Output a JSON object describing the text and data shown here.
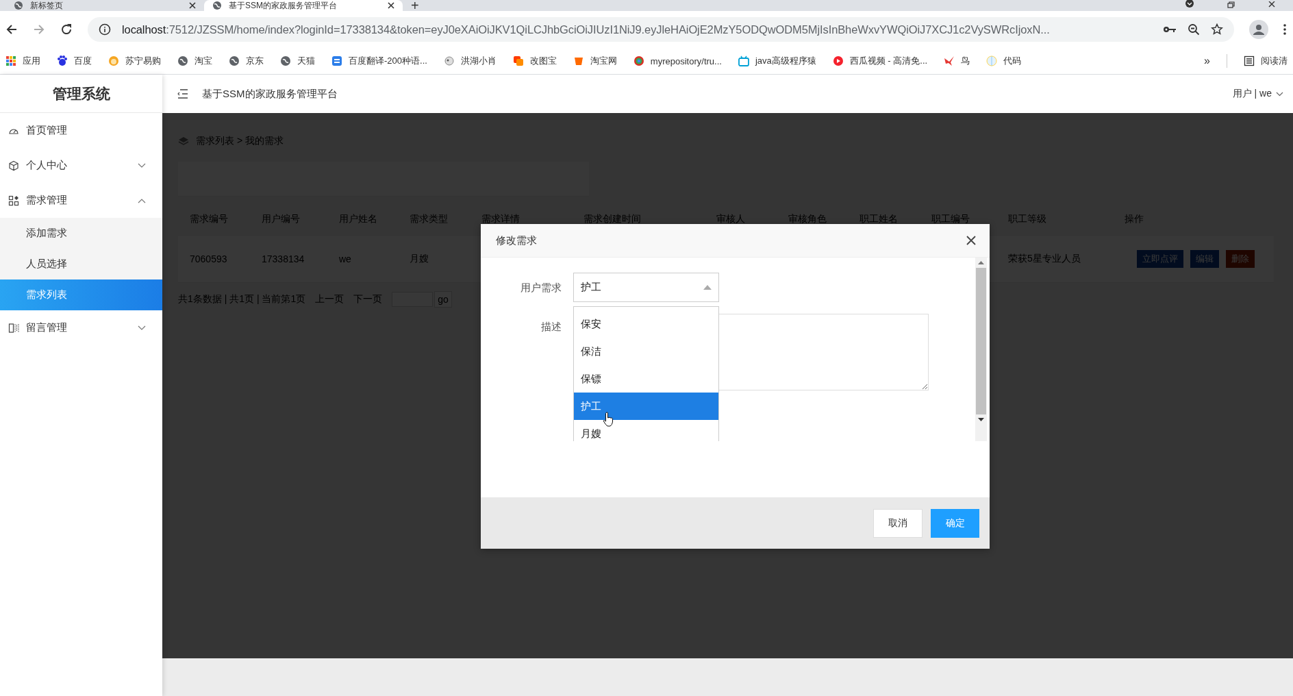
{
  "browser": {
    "tabs": [
      {
        "title": "新标签页",
        "selected": false
      },
      {
        "title": "基于SSM的家政服务管理平台",
        "selected": true
      }
    ],
    "new_tab": "+",
    "url_host": "localhost",
    "url_rest": ":7512/JZSSM/home/index?loginId=17338134&token=eyJ0eXAiOiJKV1QiLCJhbGciOiJIUzI1NiJ9.eyJleHAiOjE2MzY5ODQwODM5MjIsInBheWxvYWQiOiJ7XCJ1c2VySWRcIjoxN...",
    "bookmarks": [
      {
        "label": "应用"
      },
      {
        "label": "百度"
      },
      {
        "label": "苏宁易购"
      },
      {
        "label": "淘宝"
      },
      {
        "label": "京东"
      },
      {
        "label": "天猫"
      },
      {
        "label": "百度翻译-200种语..."
      },
      {
        "label": "洪湖小肖"
      },
      {
        "label": "改图宝"
      },
      {
        "label": "淘宝网"
      },
      {
        "label": "myrepository/tru..."
      },
      {
        "label": "java高级程序猿"
      },
      {
        "label": "西瓜视频 - 高清免..."
      },
      {
        "label": "鸟"
      },
      {
        "label": "代码"
      }
    ],
    "bookmarks_more": "»",
    "reading_list": "阅读清"
  },
  "app": {
    "logo": "管理系统",
    "title": "基于SSM的家政服务管理平台",
    "user_menu": "用户 | we"
  },
  "sidebar": {
    "items": [
      {
        "label": "首页管理",
        "kind": "link",
        "selected": false
      },
      {
        "label": "个人中心",
        "kind": "group",
        "expanded": false
      },
      {
        "label": "需求管理",
        "kind": "group",
        "expanded": true,
        "children": [
          {
            "label": "添加需求",
            "selected": false
          },
          {
            "label": "人员选择",
            "selected": false
          },
          {
            "label": "需求列表",
            "selected": true
          }
        ]
      },
      {
        "label": "留言管理",
        "kind": "group",
        "expanded": false
      }
    ]
  },
  "breadcrumb": "需求列表 > 我的需求",
  "table": {
    "columns": [
      "需求编号",
      "用户编号",
      "用户姓名",
      "需求类型",
      "需求详情",
      "需求创建时间",
      "审核人",
      "审核角色",
      "职工姓名",
      "职工编号",
      "职工等级",
      "操作"
    ],
    "rows": [
      {
        "demand_id": "7060593",
        "user_id": "17338134",
        "user_name": "we",
        "demand_type": "月嫂",
        "staff_level": "荣获5星专业人员",
        "actions": [
          {
            "label": "立即点评",
            "kind": "primary"
          },
          {
            "label": "编辑",
            "kind": "primary"
          },
          {
            "label": "删除",
            "kind": "danger"
          }
        ]
      }
    ]
  },
  "pagination": {
    "summary": "共1条数据 | 共1页 | 当前第1页",
    "prev": "上一页",
    "next": "下一页",
    "go": "go"
  },
  "dialog": {
    "title": "修改需求",
    "fields": [
      {
        "label": "用户需求",
        "kind": "select",
        "value": "护工",
        "open": true,
        "options": [
          {
            "label": "保安",
            "selected": false
          },
          {
            "label": "保洁",
            "selected": false
          },
          {
            "label": "保镖",
            "selected": false
          },
          {
            "label": "护工",
            "selected": true
          },
          {
            "label": "月嫂",
            "selected": false
          }
        ]
      },
      {
        "label": "描述",
        "kind": "textarea"
      }
    ],
    "buttons": [
      {
        "label": "取消",
        "kind": "secondary"
      },
      {
        "label": "确定",
        "kind": "primary"
      }
    ]
  }
}
